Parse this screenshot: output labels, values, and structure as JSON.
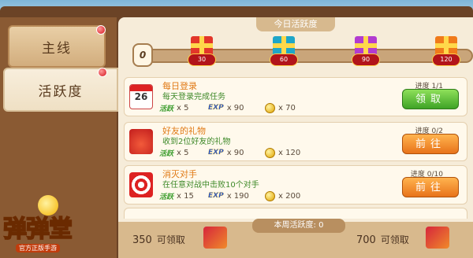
{
  "tabs": [
    {
      "label": "主线",
      "active": false
    },
    {
      "label": "活跃度",
      "active": true
    }
  ],
  "logo": {
    "text": "弹弹堂",
    "sub": "官方正版手游"
  },
  "header": {
    "label": "今日活跃度"
  },
  "progress": {
    "current": "0",
    "milestones": [
      "30",
      "60",
      "90",
      "120"
    ]
  },
  "tasks": [
    {
      "title": "每日登录",
      "desc": "每天登录完成任务",
      "icon": "calendar-icon",
      "calendar_day": "26",
      "rewards": {
        "activity": "x 5",
        "exp": "x 90",
        "coins": "x 70"
      },
      "progress": "进度 1/1",
      "button": "领取",
      "button_style": "green"
    },
    {
      "title": "好友的礼物",
      "desc": "收到2位好友的礼物",
      "icon": "gift-box-icon",
      "rewards": {
        "activity": "x 5",
        "exp": "x 90",
        "coins": "x 120"
      },
      "progress": "进度 0/2",
      "button": "前往",
      "button_style": "orange"
    },
    {
      "title": "消灭对手",
      "desc": "在任意对战中击败10个对手",
      "icon": "target-icon",
      "rewards": {
        "activity": "x 15",
        "exp": "x 190",
        "coins": "x 200"
      },
      "progress": "进度 0/10",
      "button": "前往",
      "button_style": "orange"
    }
  ],
  "reward_labels": {
    "activity": "活跃",
    "exp": "EXP"
  },
  "weekly": {
    "label": "本周活跃度: 0",
    "claims": [
      {
        "amount": "350",
        "text": "可领取"
      },
      {
        "amount": "700",
        "text": "可领取"
      }
    ]
  },
  "colors": {
    "button_green": "#3fa326",
    "button_orange": "#e8731a",
    "title_orange": "#e07a16",
    "desc_green": "#3f8a2a"
  }
}
